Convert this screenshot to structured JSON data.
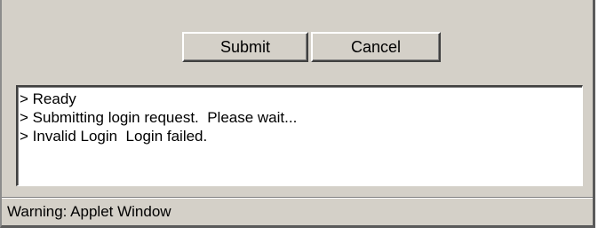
{
  "buttons": {
    "submit_label": "Submit",
    "cancel_label": "Cancel"
  },
  "log": {
    "lines": [
      "> Ready",
      "> Submitting login request.  Please wait...",
      "> Invalid Login  Login failed."
    ]
  },
  "status_bar": {
    "text": "Warning: Applet Window"
  }
}
